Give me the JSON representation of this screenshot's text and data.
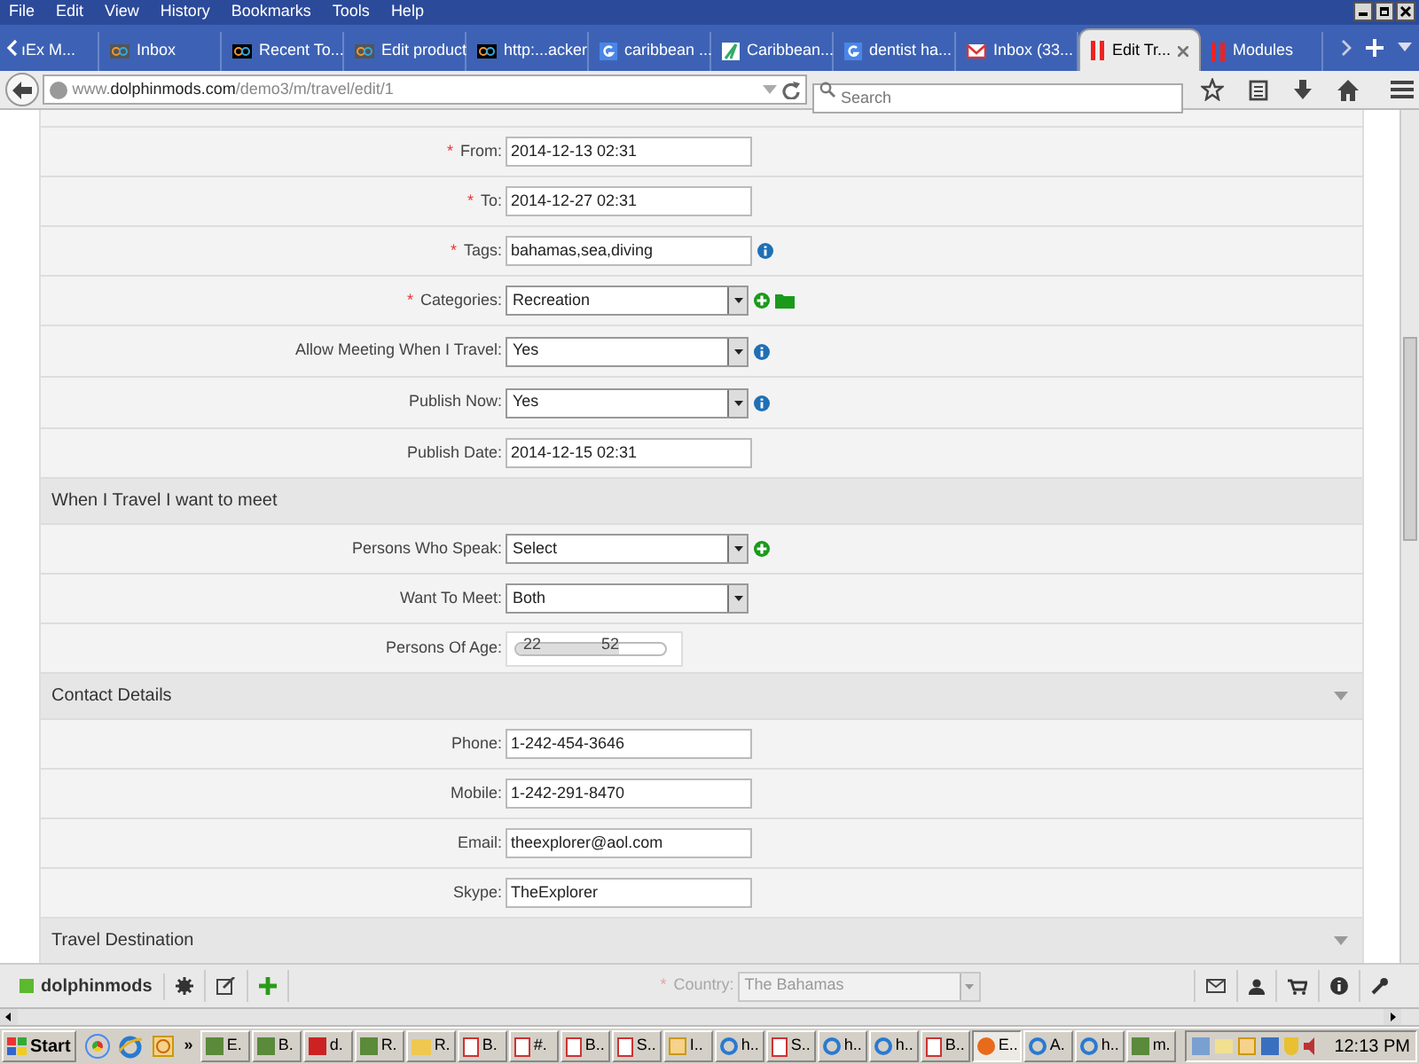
{
  "menu": [
    "File",
    "Edit",
    "View",
    "History",
    "Bookmarks",
    "Tools",
    "Help"
  ],
  "tabs": [
    {
      "label": "ıEx M...",
      "selected": false
    },
    {
      "label": "Inbox",
      "selected": false
    },
    {
      "label": "Recent To...",
      "selected": false
    },
    {
      "label": "Edit product",
      "selected": false
    },
    {
      "label": "http:...acker",
      "selected": false
    },
    {
      "label": "caribbean ...",
      "selected": false
    },
    {
      "label": "Caribbean...",
      "selected": false
    },
    {
      "label": "dentist ha...",
      "selected": false
    },
    {
      "label": "Inbox (33...",
      "selected": false
    },
    {
      "label": "Edit Tr...",
      "selected": true
    },
    {
      "label": "Modules",
      "selected": false
    }
  ],
  "address": {
    "prefix": "www.",
    "host": "dolphinmods.com",
    "path": "/demo3/m/travel/edit/1"
  },
  "search": {
    "placeholder": "Search"
  },
  "form": {
    "sections": [
      {
        "rows": [
          {
            "marker": "*",
            "label": "From:",
            "kind": "text",
            "value": "2014-12-13 02:31"
          },
          {
            "marker": "*",
            "label": "To:",
            "kind": "text",
            "value": "2014-12-27 02:31"
          },
          {
            "marker": "*",
            "label": "Tags:",
            "kind": "text",
            "value": "bahamas,sea,diving",
            "info_button": true
          },
          {
            "marker": "*",
            "label": "Categories:",
            "kind": "select",
            "value": "Recreation",
            "add_button": true,
            "folder_button": true
          },
          {
            "label": "Allow Meeting When I Travel:",
            "kind": "select",
            "value": "Yes",
            "info_button": true
          },
          {
            "label": "Publish Now:",
            "kind": "select",
            "value": "Yes",
            "info_button": true
          },
          {
            "label": "Publish Date:",
            "kind": "text",
            "value": "2014-12-15 02:31"
          }
        ]
      },
      {
        "title": "When I Travel I want to meet",
        "collapsible": false,
        "rows": [
          {
            "label": "Persons Who Speak:",
            "kind": "select",
            "value": "Select",
            "add_button": true
          },
          {
            "label": "Want To Meet:",
            "kind": "select",
            "value": "Both"
          },
          {
            "label": "Persons Of Age:",
            "kind": "range",
            "low": "22",
            "high": "52"
          }
        ]
      },
      {
        "title": "Contact Details",
        "collapsible": true,
        "rows": [
          {
            "label": "Phone:",
            "kind": "text",
            "value": "1-242-454-3646"
          },
          {
            "label": "Mobile:",
            "kind": "text",
            "value": "1-242-291-8470"
          },
          {
            "label": "Email:",
            "kind": "text",
            "value": "theexplorer@aol.com"
          },
          {
            "label": "Skype:",
            "kind": "text",
            "value": "TheExplorer"
          }
        ]
      },
      {
        "title": "Travel Destination",
        "collapsible": true,
        "rows": [
          {
            "marker": "*",
            "label": "Country:",
            "kind": "select",
            "value": "The Bahamas"
          }
        ]
      }
    ]
  },
  "toolbar": {
    "brand": "dolphinmods"
  },
  "taskbar": {
    "start": "Start",
    "more": "»",
    "buttons": [
      {
        "label": "E.",
        "selected": false
      },
      {
        "label": "B.",
        "selected": false
      },
      {
        "label": "d.",
        "selected": false
      },
      {
        "label": "R.",
        "selected": false
      },
      {
        "label": "R.",
        "selected": false
      },
      {
        "label": "B.",
        "selected": false
      },
      {
        "label": "#.",
        "selected": false
      },
      {
        "label": "B..",
        "selected": false
      },
      {
        "label": "S..",
        "selected": false
      },
      {
        "label": "I..",
        "selected": false
      },
      {
        "label": "h..",
        "selected": false
      },
      {
        "label": "S..",
        "selected": false
      },
      {
        "label": "h..",
        "selected": false
      },
      {
        "label": "h..",
        "selected": false
      },
      {
        "label": "B..",
        "selected": false
      },
      {
        "label": "E..",
        "selected": true
      },
      {
        "label": "A.",
        "selected": false
      },
      {
        "label": "h..",
        "selected": false
      },
      {
        "label": "m.",
        "selected": false
      }
    ],
    "clock": "12:13 PM"
  }
}
